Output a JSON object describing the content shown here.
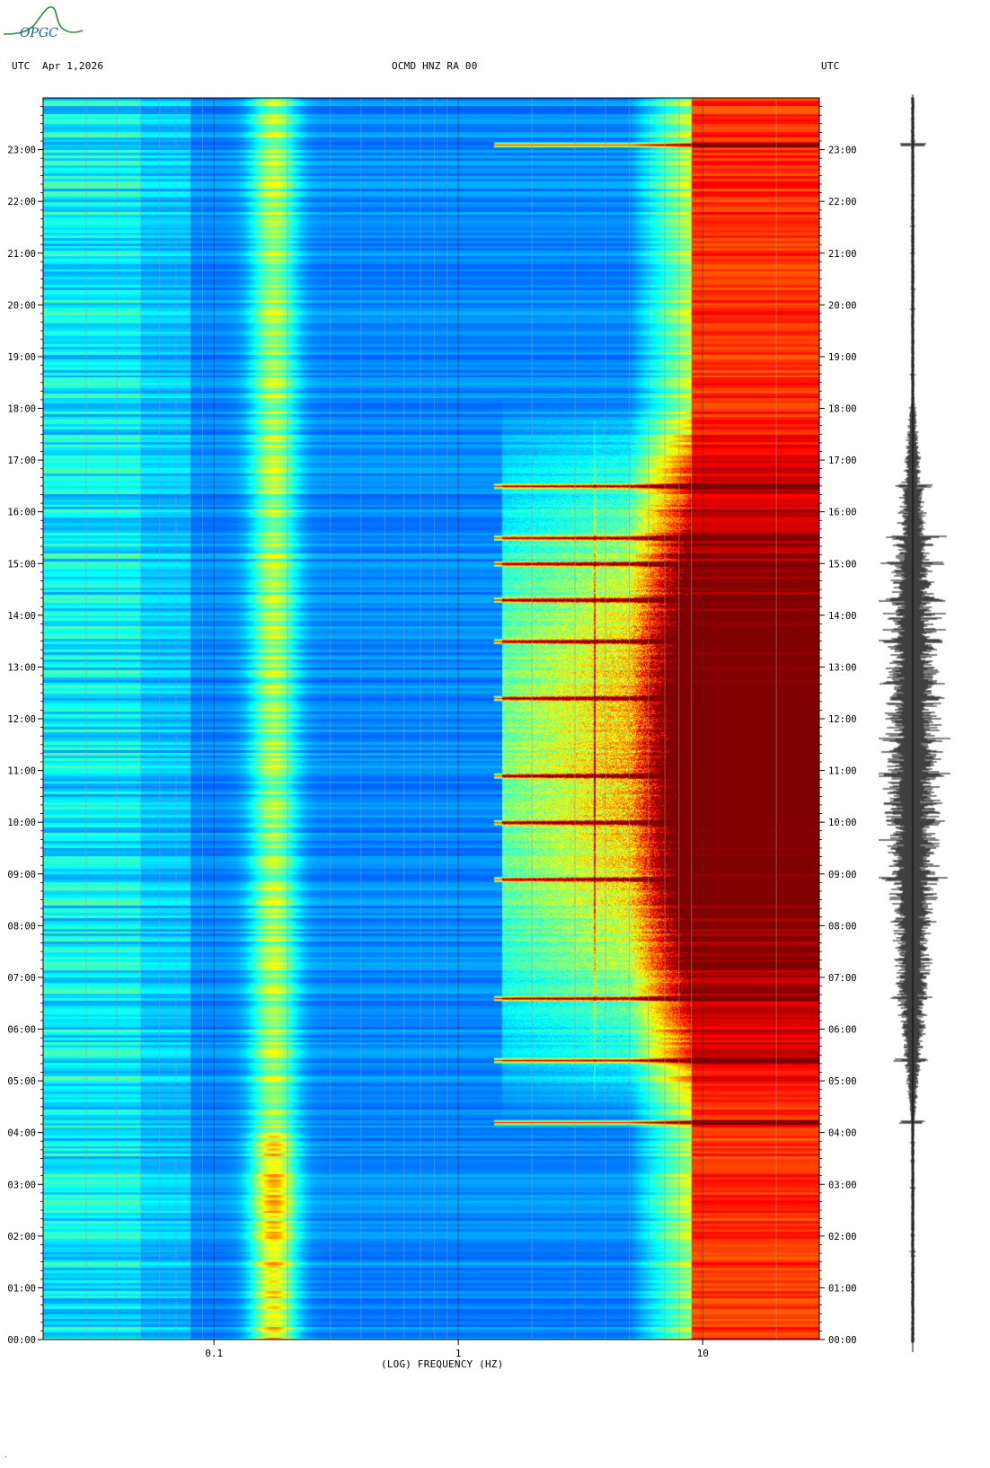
{
  "header": {
    "logo_text": "OPGC",
    "utc_left": "UTC",
    "date": "Apr 1,2026",
    "station": "OCMD HNZ RA 00",
    "utc_right": "UTC"
  },
  "chart_data": {
    "type": "heatmap",
    "title": "OCMD HNZ RA 00",
    "xlabel": "(LOG) FREQUENCY (HZ)",
    "x_scale": "log",
    "xlim": [
      0.02,
      30
    ],
    "x_ticks": [
      0.1,
      1,
      10
    ],
    "x_tick_labels": [
      "0.1",
      "1",
      "10"
    ],
    "ylim_hours": [
      0,
      24
    ],
    "y_tick_labels": [
      "00:00",
      "01:00",
      "02:00",
      "03:00",
      "04:00",
      "05:00",
      "06:00",
      "07:00",
      "08:00",
      "09:00",
      "10:00",
      "11:00",
      "12:00",
      "13:00",
      "14:00",
      "15:00",
      "16:00",
      "17:00",
      "18:00",
      "19:00",
      "20:00",
      "21:00",
      "22:00",
      "23:00"
    ],
    "colormap": [
      "#00008f",
      "#0000ff",
      "#0080ff",
      "#00ffff",
      "#80ff80",
      "#ffff00",
      "#ff8000",
      "#ff0000",
      "#800000"
    ],
    "grid": true,
    "bands": [
      {
        "name": "microseism",
        "freq": [
          0.14,
          0.22
        ],
        "intensity": 0.45
      },
      {
        "name": "cultural-noise",
        "freq": [
          8,
          30
        ],
        "intensity": 0.95
      }
    ],
    "day_activity_hours": [
      4.2,
      18.2
    ],
    "events_hours": [
      4.2,
      5.4,
      6.6,
      8.9,
      10.0,
      10.9,
      12.4,
      13.5,
      14.3,
      15.0,
      15.5,
      16.5,
      23.1
    ]
  },
  "footer": {
    "corner_mark": "′"
  }
}
